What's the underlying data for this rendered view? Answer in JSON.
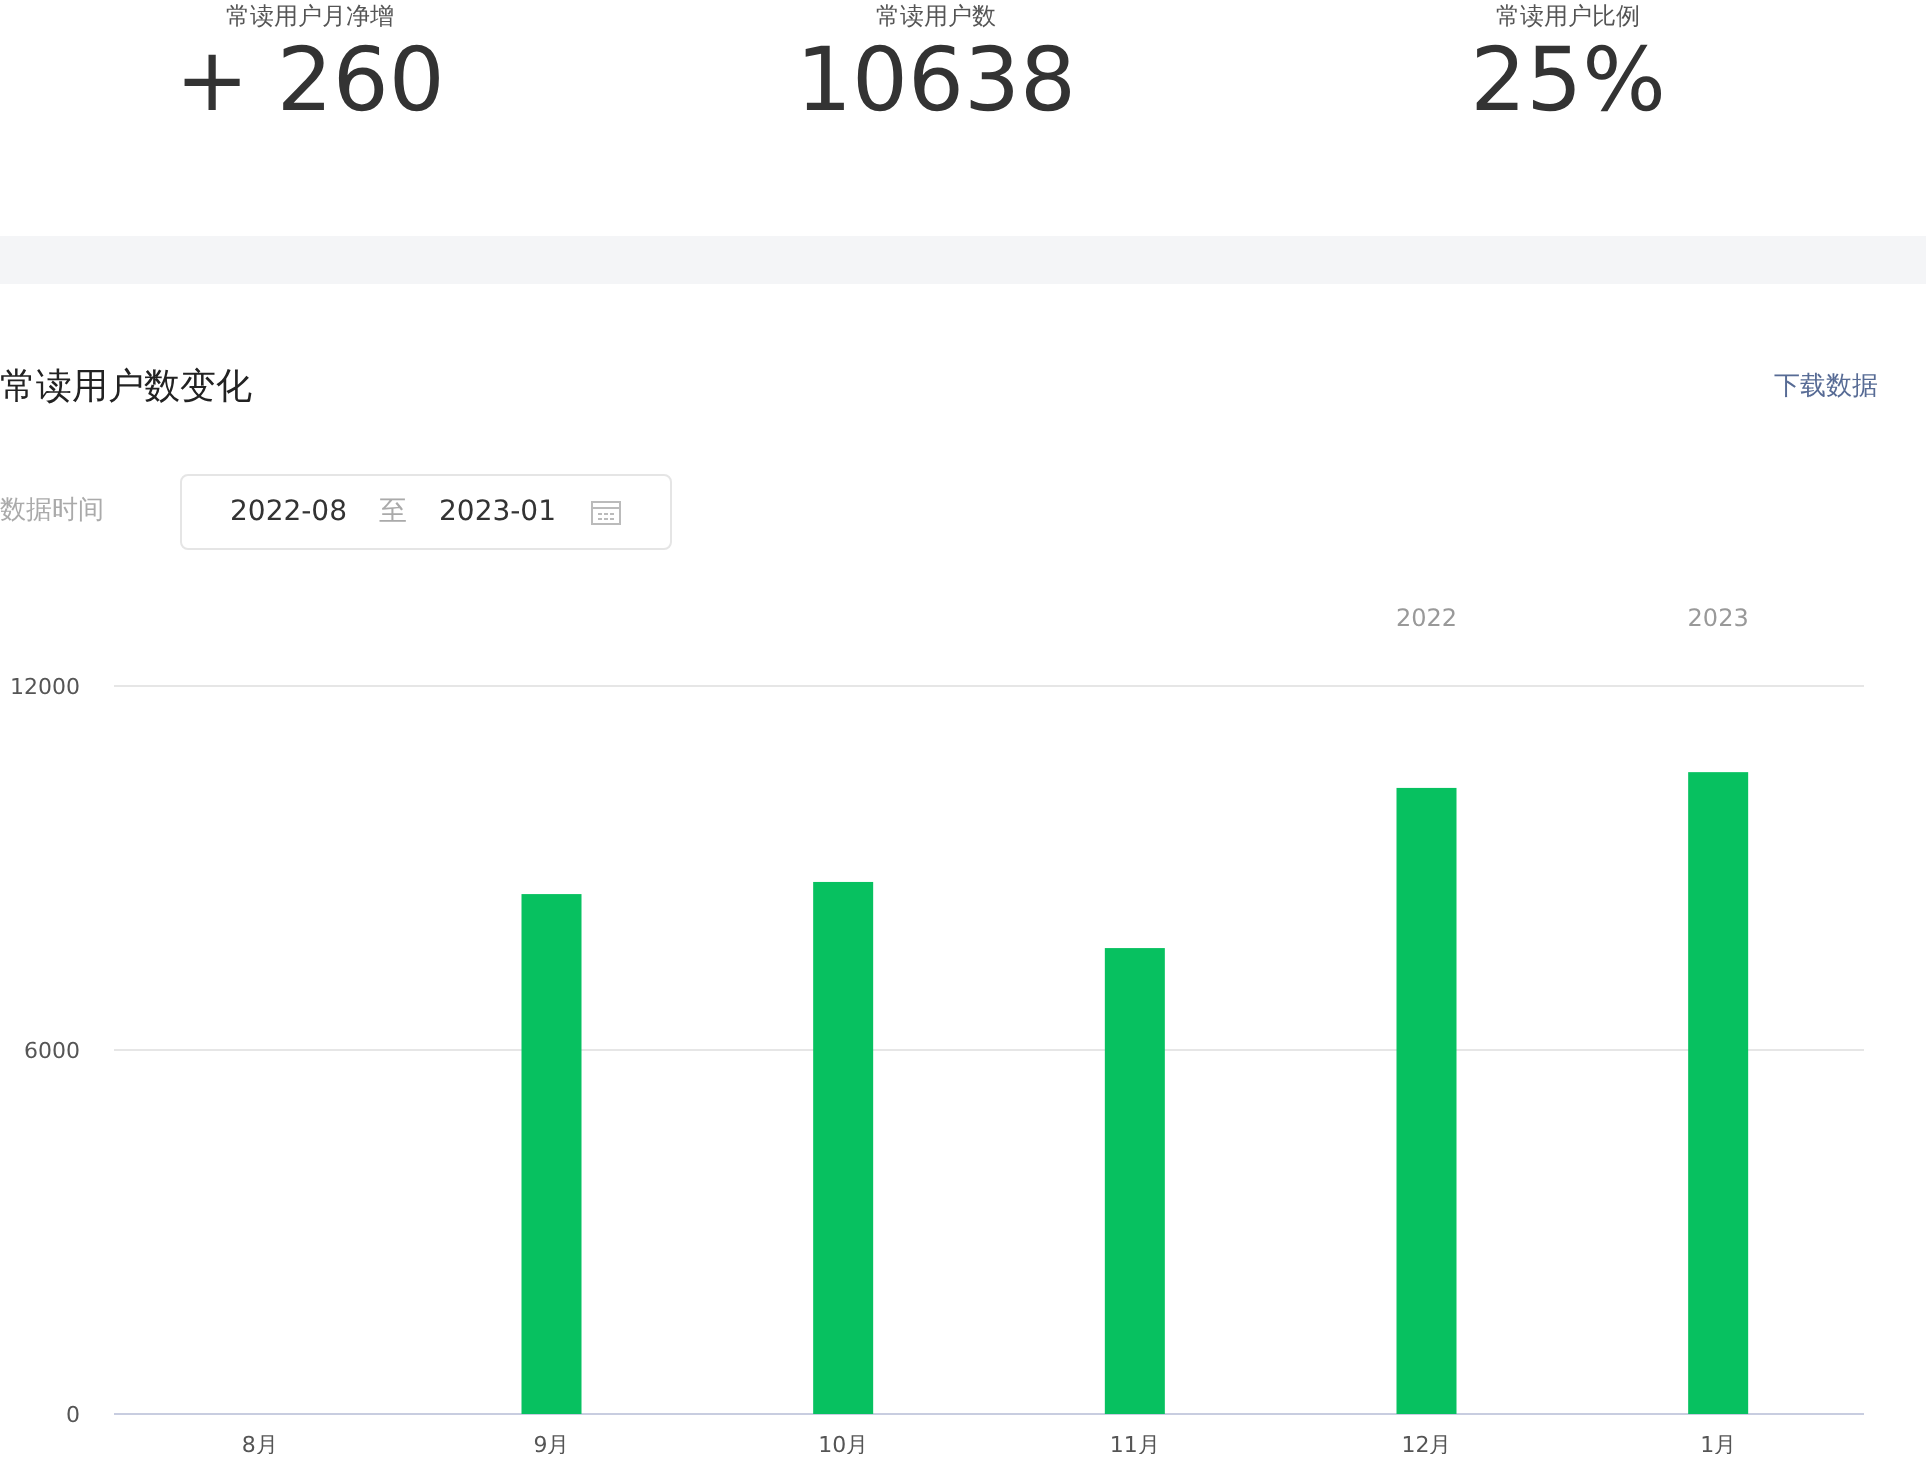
{
  "stats": [
    {
      "label": "常读用户月净增",
      "value": "+ 260"
    },
    {
      "label": "常读用户数",
      "value": "10638"
    },
    {
      "label": "常读用户比例",
      "value": "25%"
    }
  ],
  "section": {
    "title": "常读用户数变化",
    "download_link": "下载数据",
    "date_label": "数据时间",
    "date_start": "2022-08",
    "date_separator": "至",
    "date_end": "2023-01"
  },
  "chart_data": {
    "type": "bar",
    "categories": [
      "8月",
      "9月",
      "10月",
      "11月",
      "12月",
      "1月"
    ],
    "series": [
      {
        "color": "#07c160",
        "values": [
          null,
          8570,
          8770,
          7680,
          10320,
          10580
        ]
      }
    ],
    "ylim": [
      0,
      12000
    ],
    "yticks": [
      0,
      6000,
      12000
    ],
    "annotations": [
      "2022",
      "2023"
    ]
  }
}
